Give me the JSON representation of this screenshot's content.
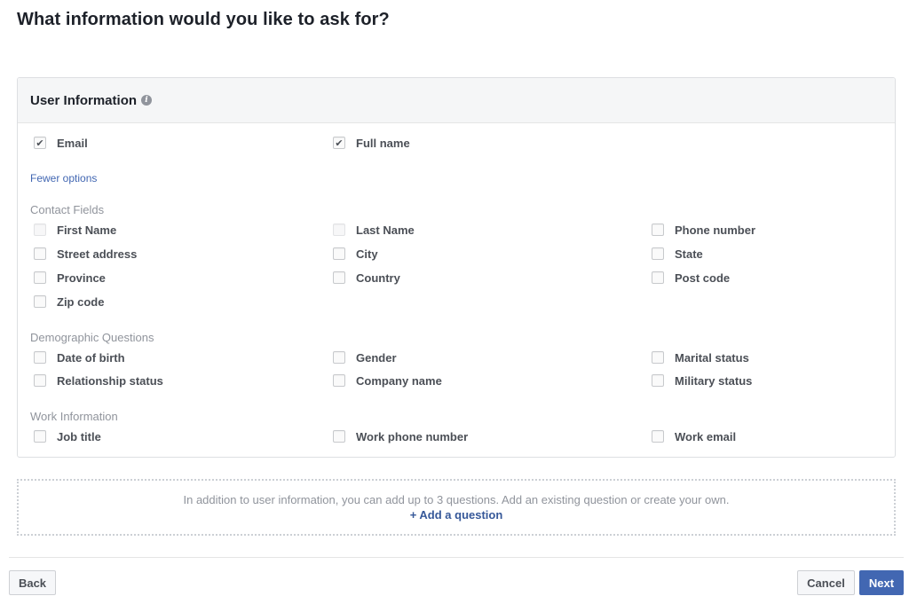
{
  "page": {
    "title": "What information would you like to ask for?"
  },
  "card": {
    "title": "User Information",
    "info_icon": "info-icon",
    "primary_fields": [
      {
        "label": "Email",
        "checked": true
      },
      {
        "label": "Full name",
        "checked": true
      }
    ],
    "toggle_link": "Fewer options",
    "sections": [
      {
        "label": "Contact Fields",
        "fields": [
          {
            "label": "First Name",
            "checked": false,
            "disabled": true
          },
          {
            "label": "Last Name",
            "checked": false,
            "disabled": true
          },
          {
            "label": "Phone number",
            "checked": false
          },
          {
            "label": "Street address",
            "checked": false
          },
          {
            "label": "City",
            "checked": false
          },
          {
            "label": "State",
            "checked": false
          },
          {
            "label": "Province",
            "checked": false
          },
          {
            "label": "Country",
            "checked": false
          },
          {
            "label": "Post code",
            "checked": false
          },
          {
            "label": "Zip code",
            "checked": false
          }
        ]
      },
      {
        "label": "Demographic Questions",
        "fields": [
          {
            "label": "Date of birth",
            "checked": false
          },
          {
            "label": "Gender",
            "checked": false
          },
          {
            "label": "Marital status",
            "checked": false
          },
          {
            "label": "Relationship status",
            "checked": false
          },
          {
            "label": "Company name",
            "checked": false
          },
          {
            "label": "Military status",
            "checked": false
          }
        ]
      },
      {
        "label": "Work Information",
        "fields": [
          {
            "label": "Job title",
            "checked": false
          },
          {
            "label": "Work phone number",
            "checked": false
          },
          {
            "label": "Work email",
            "checked": false
          }
        ]
      }
    ]
  },
  "questions": {
    "description": "In addition to user information, you can add up to 3 questions. Add an existing question or create your own.",
    "add_label": "+ Add a question"
  },
  "footer": {
    "back_label": "Back",
    "cancel_label": "Cancel",
    "next_label": "Next"
  },
  "colors": {
    "primary": "#4267b2",
    "link": "#365899"
  },
  "check_glyph": "✔"
}
